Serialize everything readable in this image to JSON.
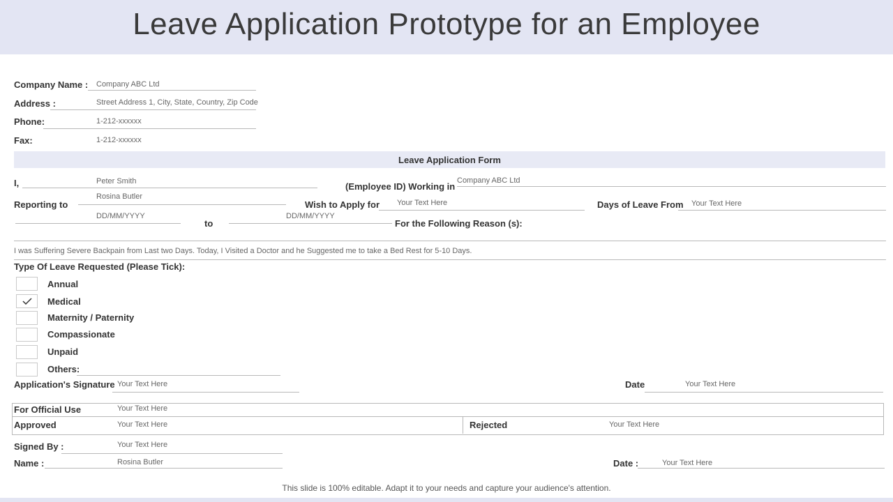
{
  "title": "Leave Application Prototype for an Employee",
  "company": {
    "name_label": "Company Name :",
    "name_value": "Company ABC Ltd",
    "address_label": "Address :",
    "address_value": "Street Address 1, City, State, Country, Zip Code",
    "phone_label": "Phone:",
    "phone_value": "1-212-xxxxxx",
    "fax_label": "Fax:",
    "fax_value": "1-212-xxxxxx"
  },
  "form": {
    "section_title": "Leave Application Form",
    "i_label": "I,",
    "i_value": "Peter Smith",
    "employee_id_label": "(Employee ID) Working in",
    "employee_id_value": "Company ABC Ltd",
    "reporting_label": "Reporting to",
    "reporting_value": "Rosina Butler",
    "wish_label": "Wish to Apply for",
    "wish_value": "Your Text Here",
    "days_label": "Days of Leave From",
    "days_value": "Your Text Here",
    "from_date": "DD/MM/YYYY",
    "to_label": "to",
    "to_date": "DD/MM/YYYY",
    "reason_label": "For the Following Reason (s):",
    "reason_text": "I was Suffering Severe Backpain from Last two Days. Today, I Visited a Doctor and he Suggested me to take a Bed Rest for 5-10 Days."
  },
  "leave_type": {
    "label": "Type Of Leave Requested (Please Tick):",
    "options": [
      {
        "label": "Annual",
        "checked": false
      },
      {
        "label": "Medical",
        "checked": true
      },
      {
        "label": "Maternity / Paternity",
        "checked": false
      },
      {
        "label": "Compassionate",
        "checked": false
      },
      {
        "label": "Unpaid",
        "checked": false
      },
      {
        "label": "Others:",
        "checked": false
      }
    ]
  },
  "signature": {
    "label": "Application's Signature",
    "value": "Your Text Here",
    "date_label": "Date",
    "date_value": "Your Text Here"
  },
  "official": {
    "label": "For Official Use",
    "value": "Your Text Here",
    "approved_label": "Approved",
    "approved_value": "Your Text Here",
    "rejected_label": "Rejected",
    "rejected_value": "Your Text Here"
  },
  "signed": {
    "signed_by_label": "Signed By :",
    "signed_by_value": "Your Text Here",
    "name_label": "Name :",
    "name_value": "Rosina Butler",
    "date_label": "Date :",
    "date_value": "Your Text Here"
  },
  "footer_note": "This slide is 100% editable. Adapt it to your needs and capture your audience's attention.",
  "colors": {
    "header_band": "#e3e5f3",
    "section_band": "#e8eaf5"
  }
}
